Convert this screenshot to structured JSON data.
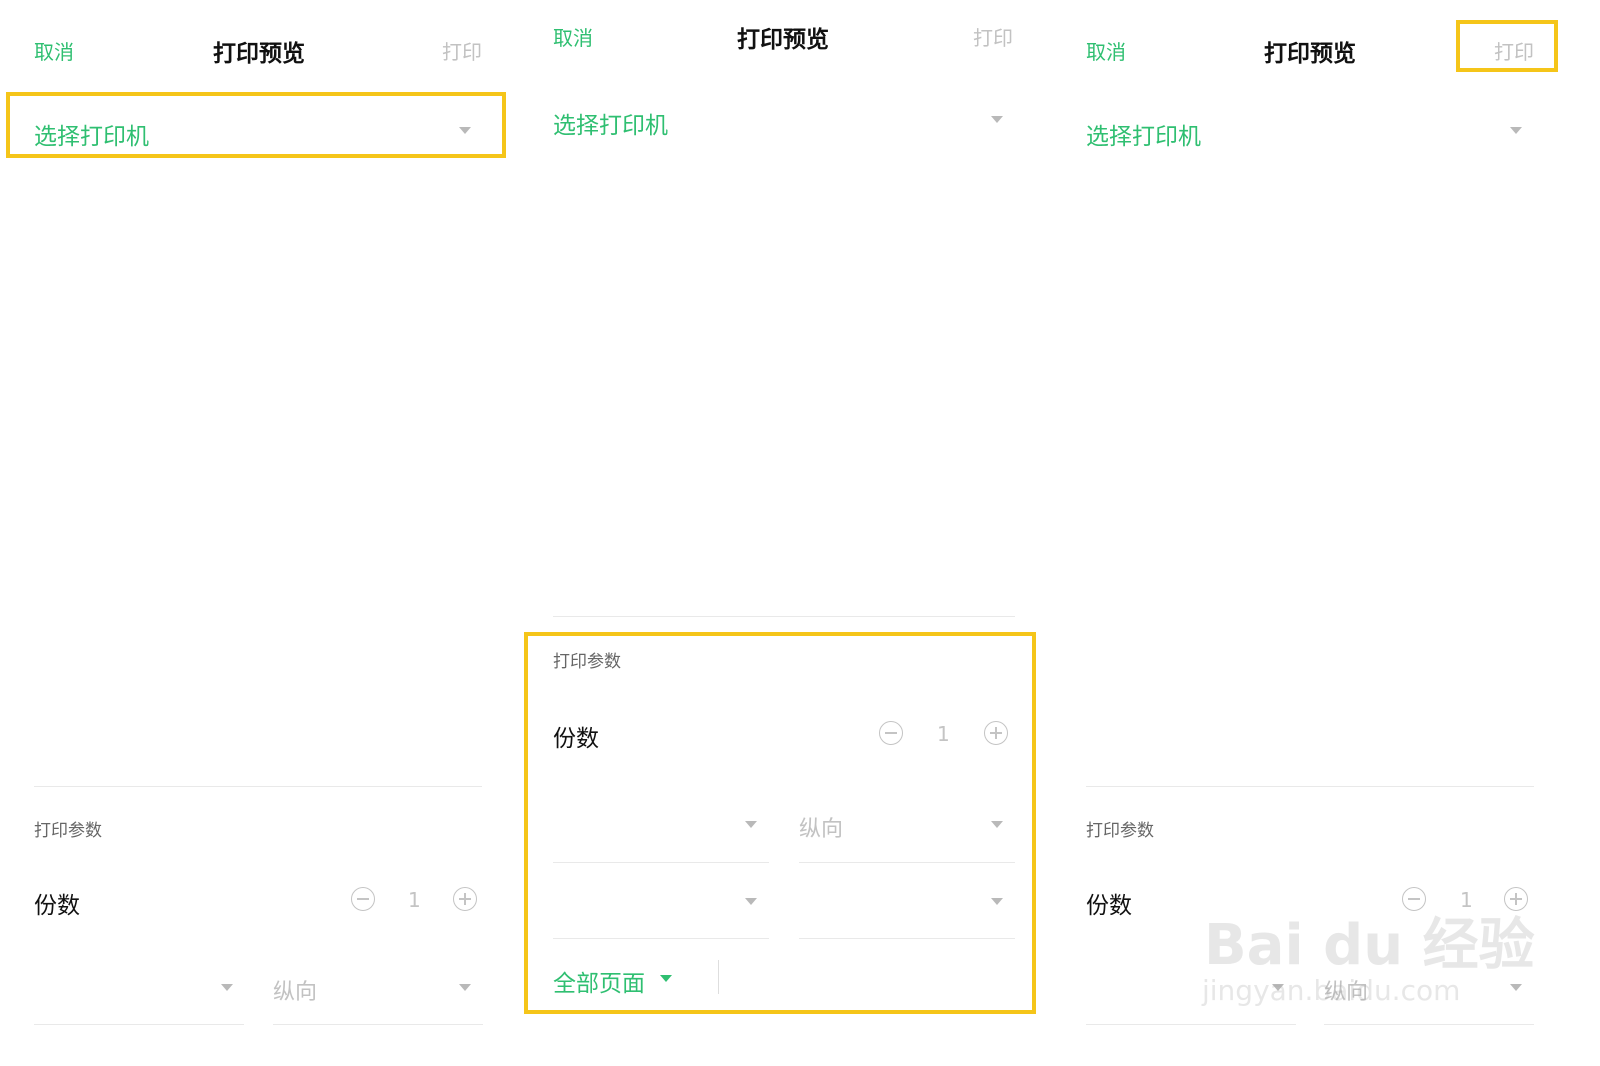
{
  "panels": [
    {
      "cancel": "取消",
      "title": "打印预览",
      "print": "打印",
      "printer": "选择打印机",
      "section": "打印参数",
      "copies_label": "份数",
      "copies_value": "1",
      "orientation": "纵向"
    },
    {
      "cancel": "取消",
      "title": "打印预览",
      "print": "打印",
      "printer": "选择打印机",
      "section": "打印参数",
      "copies_label": "份数",
      "copies_value": "1",
      "orientation": "纵向",
      "pages": "全部页面"
    },
    {
      "cancel": "取消",
      "title": "打印预览",
      "print": "打印",
      "printer": "选择打印机",
      "section": "打印参数",
      "copies_label": "份数",
      "copies_value": "1",
      "orientation": "纵向"
    }
  ],
  "watermark": {
    "brand": "Bai du 经验",
    "url": "jingyan.baidu.com"
  },
  "colors": {
    "accent_green": "#2fbf71",
    "highlight_yellow": "#f5c519",
    "disabled_gray": "#c2c2c2"
  }
}
